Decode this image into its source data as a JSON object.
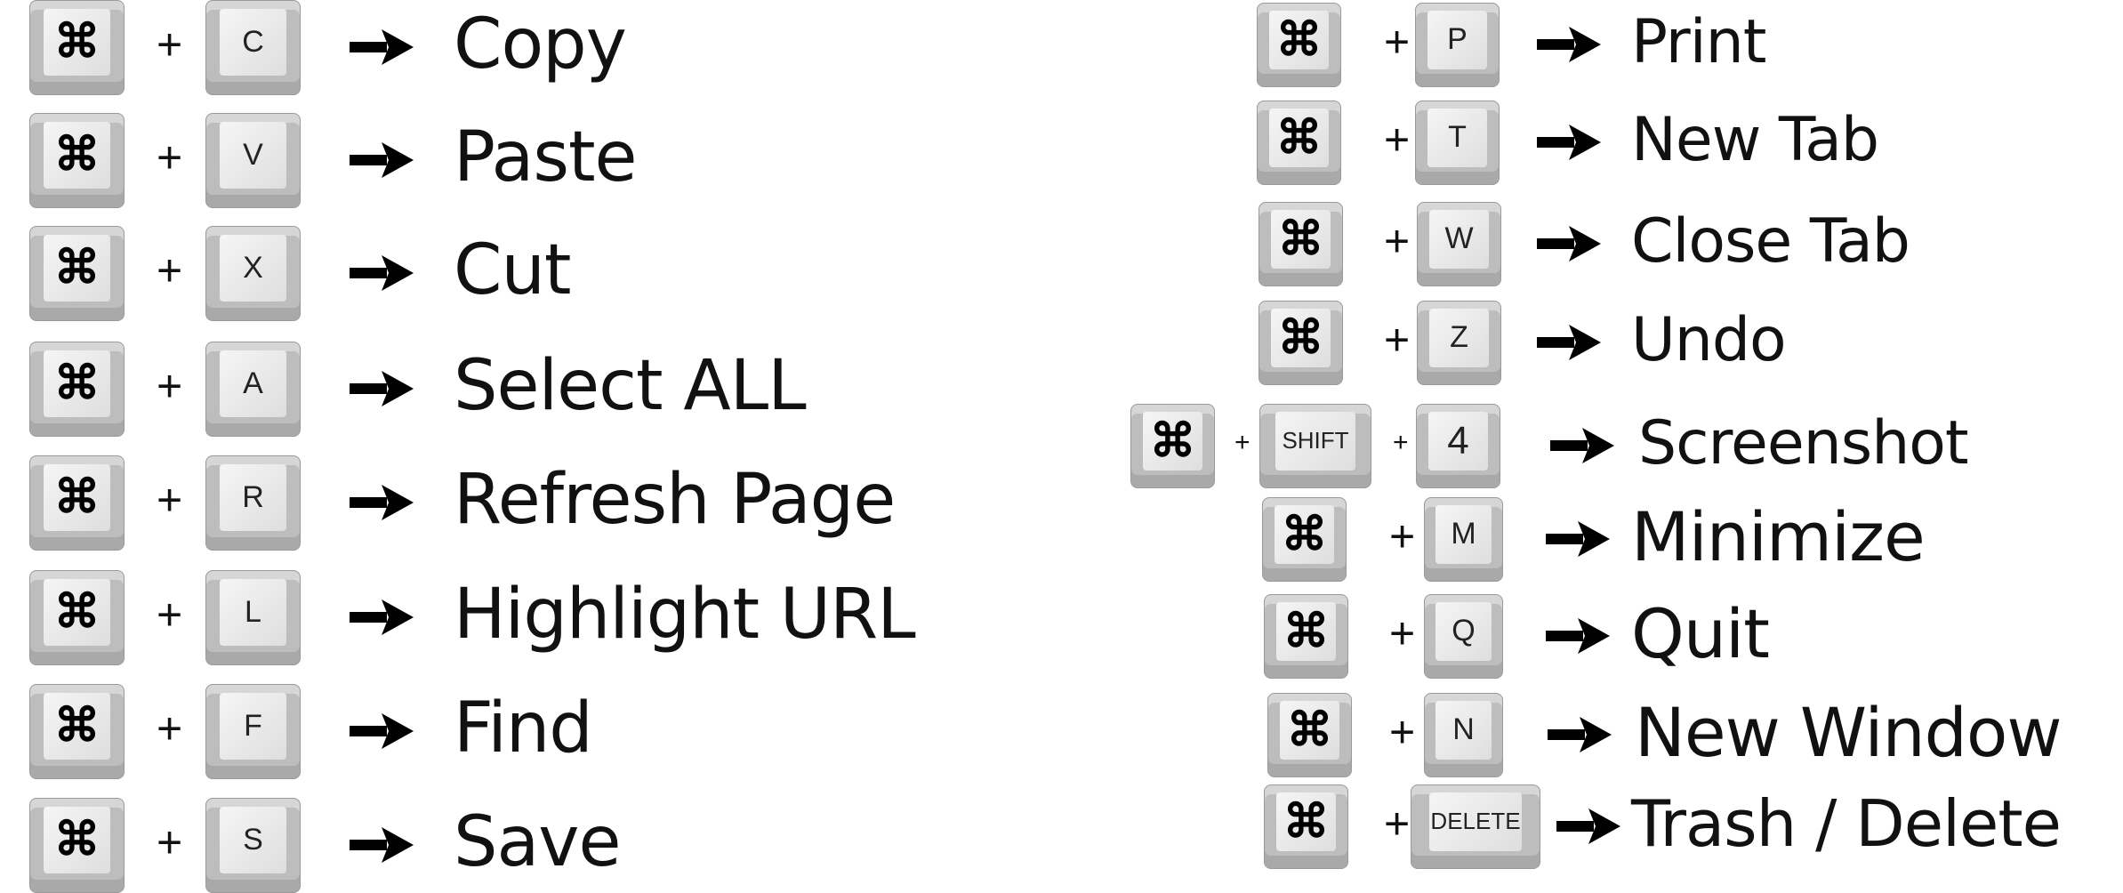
{
  "cmd_symbol": "⌘",
  "plus": "+",
  "left": [
    {
      "key": "C",
      "action": "Copy"
    },
    {
      "key": "V",
      "action": "Paste"
    },
    {
      "key": "X",
      "action": "Cut"
    },
    {
      "key": "A",
      "action": "Select  ALL"
    },
    {
      "key": "R",
      "action": "Refresh Page"
    },
    {
      "key": "L",
      "action": "Highlight URL"
    },
    {
      "key": "F",
      "action": "Find"
    },
    {
      "key": "S",
      "action": "Save"
    }
  ],
  "right": [
    {
      "key": "P",
      "action": "Print"
    },
    {
      "key": "T",
      "action": "New Tab"
    },
    {
      "key": "W",
      "action": "Close Tab"
    },
    {
      "key": "Z",
      "action": "Undo"
    },
    {
      "key": "SHIFT",
      "key2": "4",
      "action": "Screenshot"
    },
    {
      "key": "M",
      "action": "Minimize"
    },
    {
      "key": "Q",
      "action": "Quit"
    },
    {
      "key": "N",
      "action": "New Window"
    },
    {
      "key": "DELETE",
      "action": "Trash / Delete"
    }
  ]
}
